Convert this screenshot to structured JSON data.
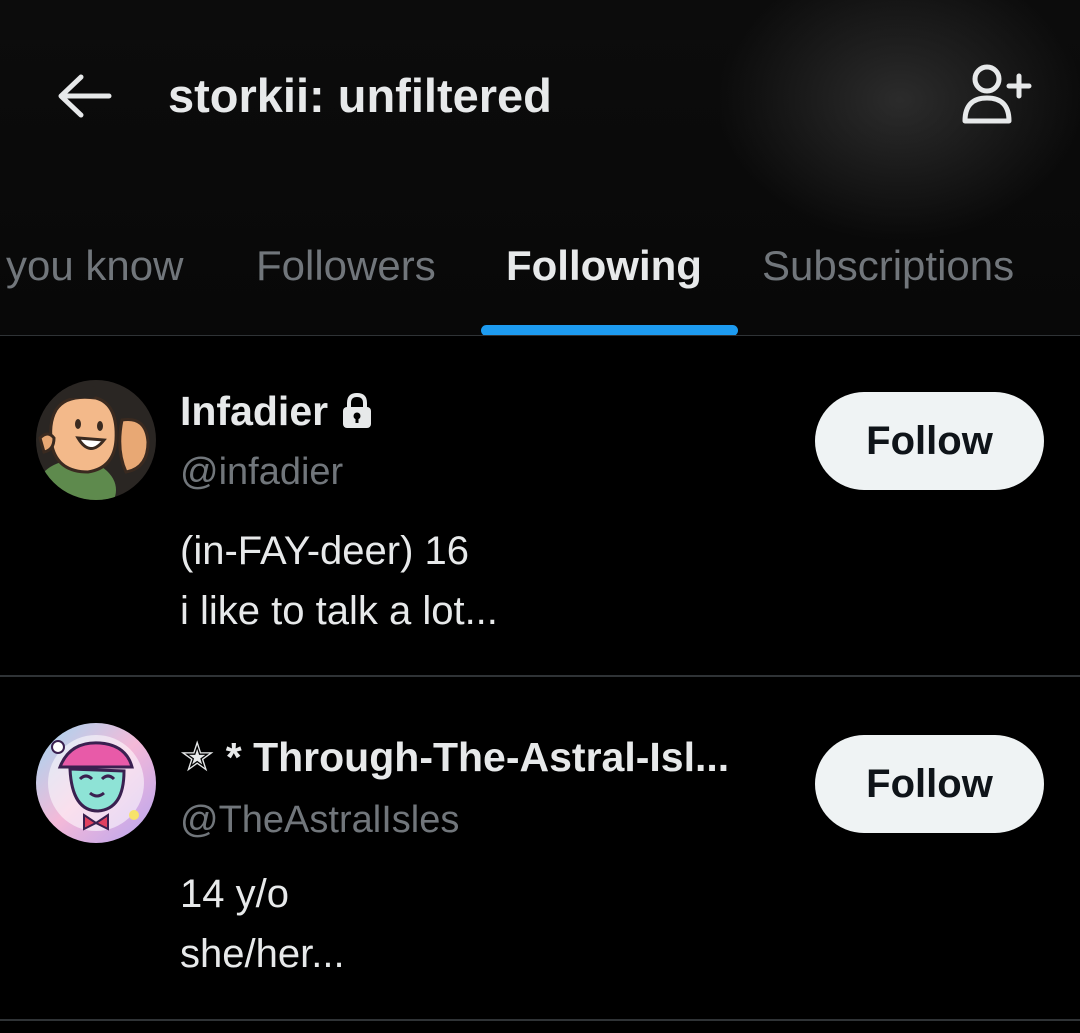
{
  "header": {
    "title": "storkii: unfiltered",
    "back_icon": "arrow-left-icon",
    "add_user_icon": "person-plus-icon"
  },
  "tabs": [
    {
      "label": "you know",
      "active": false
    },
    {
      "label": "Followers",
      "active": false
    },
    {
      "label": "Following",
      "active": true
    },
    {
      "label": "Subscriptions",
      "active": false
    }
  ],
  "colors": {
    "accent": "#1d9bf0",
    "background": "#000000",
    "text_primary": "#e7e9ea",
    "text_secondary": "#71767b",
    "button_bg": "#eff3f4",
    "divider": "#2f3336"
  },
  "users": [
    {
      "name": "Infadier",
      "protected": true,
      "protected_icon": "lock-icon",
      "handle": "@infadier",
      "bio_lines": [
        "(in-FAY-deer) 16",
        "i like to talk a lot..."
      ],
      "button_label": "Follow"
    },
    {
      "name": "✭ * Through-The-Astral-Isl...",
      "protected": false,
      "handle": "@TheAstralIsles",
      "bio_lines": [
        "14 y/o",
        "she/her..."
      ],
      "button_label": "Follow"
    }
  ]
}
